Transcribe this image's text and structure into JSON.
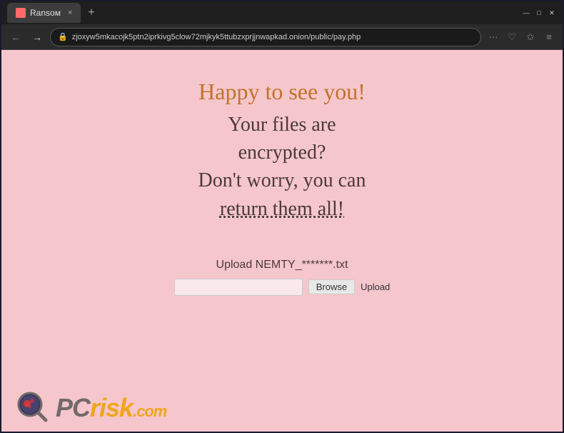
{
  "browser": {
    "tab": {
      "title": "Ransом",
      "favicon_color": "#ff6b6b",
      "close_label": "×",
      "new_tab_label": "+"
    },
    "window_controls": {
      "minimize": "—",
      "maximize": "□",
      "close": "✕"
    },
    "nav": {
      "back_icon": "←",
      "forward_icon": "→",
      "lock_icon": "🔒",
      "url": "zjoxyw5mkacojk5ptn2iprkivg5clow72mjkyk5ttubzxprjjnwapkad.onion/public/pay.php",
      "dots_icon": "···",
      "heart_icon": "♡",
      "star_icon": "✩",
      "menu_icon": "≡"
    }
  },
  "page": {
    "background_color": "#f5c6cb",
    "headline": "Happy to see you!",
    "body_lines": [
      "Your files are",
      "encrypted?",
      "Don't worry, you can",
      "return them all!"
    ],
    "upload": {
      "label": "Upload NEMTY_*******.txt",
      "browse_label": "Browse",
      "upload_label": "Upload"
    }
  },
  "watermark": {
    "brand": "PC",
    "suffix": "risk",
    "tld": ".com"
  }
}
